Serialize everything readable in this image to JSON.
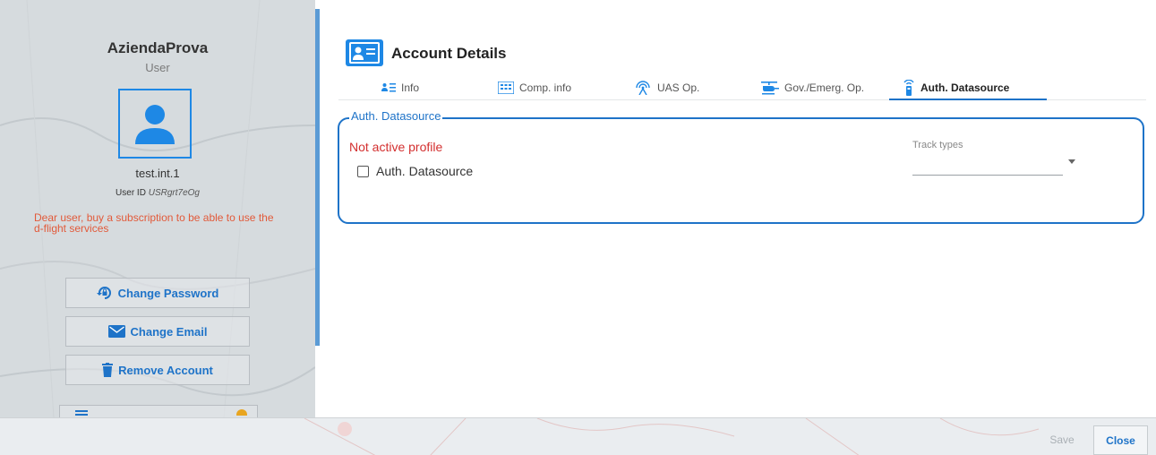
{
  "profile": {
    "company": "AziendaProva",
    "role": "User",
    "username": "test.int.1",
    "user_id_label": "User ID",
    "user_id_value": "USRgrt7eOg",
    "warning": "Dear user, buy a subscription to be able to use the d-flight services",
    "avatar_icon": "user-icon"
  },
  "actions": {
    "change_password": "Change Password",
    "change_email": "Change Email",
    "remove_account": "Remove Account"
  },
  "header": {
    "title": "Account Details",
    "icon": "id-card-icon"
  },
  "tabs": [
    {
      "label": "Info",
      "icon": "person-list-icon"
    },
    {
      "label": "Comp. info",
      "icon": "building-icon"
    },
    {
      "label": "UAS Op.",
      "icon": "signal-tower-icon"
    },
    {
      "label": "Gov./Emerg. Op.",
      "icon": "helicopter-icon"
    },
    {
      "label": "Auth. Datasource",
      "icon": "remote-control-icon"
    }
  ],
  "active_tab": "Auth. Datasource",
  "section": {
    "legend": "Auth. Datasource",
    "status": "Not active profile",
    "checkbox_label": "Auth. Datasource",
    "checkbox_checked": false,
    "track_types_label": "Track types",
    "track_types_value": ""
  },
  "footer": {
    "save_label": "Save",
    "close_label": "Close"
  },
  "colors": {
    "accent": "#1e73c8",
    "icon_blue": "#1e88e5",
    "warning": "#e25a3a",
    "error": "#d32f2f"
  }
}
